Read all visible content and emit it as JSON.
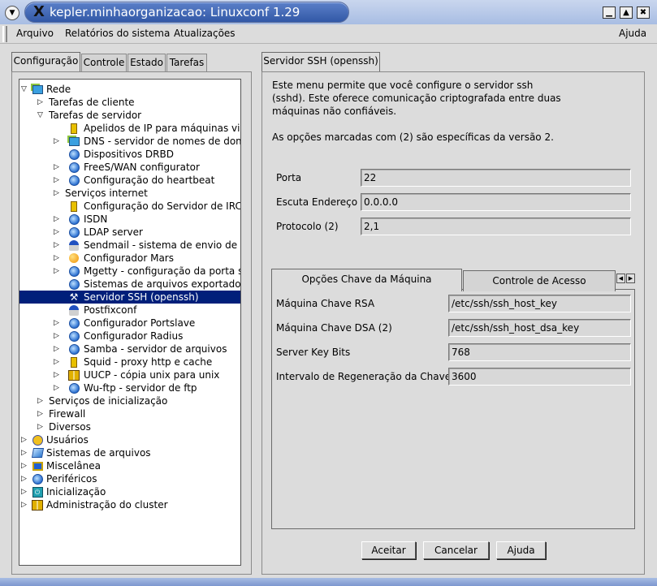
{
  "window": {
    "title": "kepler.minhaorganizacao: Linuxconf 1.29",
    "menu_icon": "chevron-down-icon",
    "controls": [
      "minimize-icon",
      "maximize-icon",
      "close-icon"
    ]
  },
  "menubar": {
    "items": [
      "Arquivo",
      "Relatórios do sistema",
      "Atualizações"
    ],
    "help": "Ajuda"
  },
  "left_tabs": [
    "Configuração",
    "Controle",
    "Estado",
    "Tarefas"
  ],
  "tree": [
    {
      "label": "Rede",
      "arrow": "▽",
      "icon": "globe-network-icon"
    },
    {
      "label": "Tarefas de cliente",
      "arrow": "▷",
      "icon": ""
    },
    {
      "label": "Tarefas de servidor",
      "arrow": "▽",
      "icon": ""
    },
    {
      "label": "Apelidos de IP para máquinas virtu",
      "arrow": "",
      "icon": "yellow-tool-icon"
    },
    {
      "label": "DNS - servidor de nomes de domír",
      "arrow": "▷",
      "icon": "network-icon"
    },
    {
      "label": "Dispositivos DRBD",
      "arrow": "",
      "icon": "globe-icon"
    },
    {
      "label": "FreeS/WAN configurator",
      "arrow": "▷",
      "icon": "globe-icon"
    },
    {
      "label": "Configuração do heartbeat",
      "arrow": "▷",
      "icon": "globe-icon"
    },
    {
      "label": "Serviços internet",
      "arrow": "▷",
      "icon": ""
    },
    {
      "label": "Configuração do Servidor de IRCd",
      "arrow": "",
      "icon": "yellow-tool-icon"
    },
    {
      "label": "ISDN",
      "arrow": "▷",
      "icon": "globe-icon"
    },
    {
      "label": "LDAP server",
      "arrow": "▷",
      "icon": "globe-icon"
    },
    {
      "label": "Sendmail - sistema de envio de em",
      "arrow": "▷",
      "icon": "mail-person-icon"
    },
    {
      "label": "Configurador Mars",
      "arrow": "▷",
      "icon": "orange-ball-icon"
    },
    {
      "label": "Mgetty - configuração da porta ser",
      "arrow": "▷",
      "icon": "globe-icon"
    },
    {
      "label": "Sistemas de arquivos exportados (l",
      "arrow": "",
      "icon": "globe-icon"
    },
    {
      "label": "Servidor SSH (openssh)",
      "arrow": "",
      "icon": "tools-icon",
      "selected": true
    },
    {
      "label": "Postfixconf",
      "arrow": "",
      "icon": "mail-person-icon"
    },
    {
      "label": "Configurador Portslave",
      "arrow": "▷",
      "icon": "globe-icon"
    },
    {
      "label": "Configurador Radius",
      "arrow": "▷",
      "icon": "globe-icon"
    },
    {
      "label": "Samba - servidor de arquivos",
      "arrow": "▷",
      "icon": "globe-icon"
    },
    {
      "label": "Squid - proxy http e cache",
      "arrow": "▷",
      "icon": "yellow-tool-icon"
    },
    {
      "label": "UUCP - cópia unix para unix",
      "arrow": "▷",
      "icon": "cluster-icon"
    },
    {
      "label": "Wu-ftp - servidor de ftp",
      "arrow": "▷",
      "icon": "globe-icon"
    },
    {
      "label": "Serviços de inicialização",
      "arrow": "▷",
      "icon": ""
    },
    {
      "label": "Firewall",
      "arrow": "▷",
      "icon": ""
    },
    {
      "label": "Diversos",
      "arrow": "▷",
      "icon": ""
    },
    {
      "label": "Usuários",
      "arrow": "▷",
      "icon": "users-icon"
    },
    {
      "label": "Sistemas de arquivos",
      "arrow": "▷",
      "icon": "filesystem-icon"
    },
    {
      "label": "Miscelânea",
      "arrow": "▷",
      "icon": "monitor-icon"
    },
    {
      "label": "Periféricos",
      "arrow": "▷",
      "icon": "globe-icon"
    },
    {
      "label": "Inicialização",
      "arrow": "▷",
      "icon": "power-icon"
    },
    {
      "label": "Administração do cluster",
      "arrow": "▷",
      "icon": "cluster-icon"
    }
  ],
  "right": {
    "tab": "Servidor SSH (openssh)",
    "description": "Este menu permite que você configure o servidor ssh\n(sshd). Este oferece comunicação criptografada entre duas\nmáquinas não confiáveis.\n\nAs opções marcadas com (2) são específicas da versão 2.",
    "fields": [
      {
        "label": "Porta",
        "value": "22"
      },
      {
        "label": "Escuta Endereço",
        "value": "0.0.0.0"
      },
      {
        "label": "Protocolo (2)",
        "value": "2,1"
      }
    ],
    "subtabs": [
      "Opções Chave da Máquina",
      "Controle de Acesso"
    ],
    "subfields": [
      {
        "label": "Máquina Chave RSA",
        "value": "/etc/ssh/ssh_host_key"
      },
      {
        "label": "Máquina Chave DSA (2)",
        "value": "/etc/ssh/ssh_host_dsa_key"
      },
      {
        "label": "Server Key Bits",
        "value": "768"
      },
      {
        "label": "Intervalo de Regeneração da Chave",
        "value": "3600"
      }
    ],
    "buttons": [
      "Aceitar",
      "Cancelar",
      "Ajuda"
    ]
  }
}
